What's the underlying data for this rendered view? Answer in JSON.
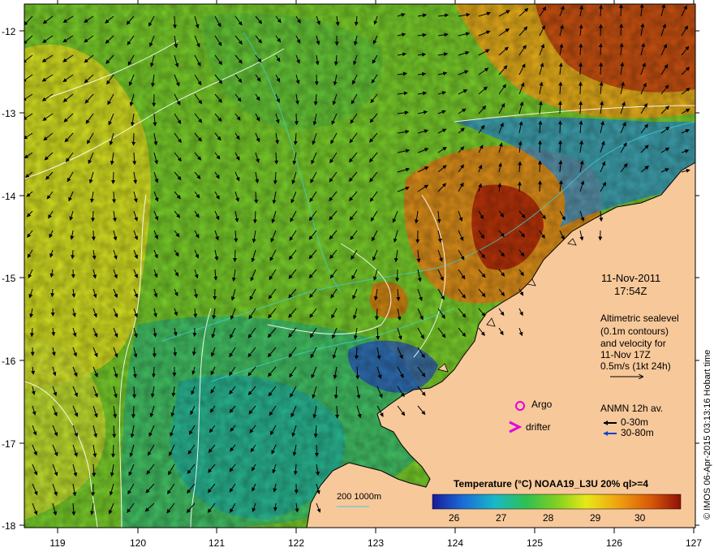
{
  "map": {
    "date": "11-Nov-2011",
    "time": "17:54Z",
    "credit": "© IMOS 06-Apr-2015 03:13:16 Hobart time",
    "latitude_ticks": [
      "-12",
      "-13",
      "-14",
      "-15",
      "-16",
      "-17",
      "-18"
    ],
    "longitude_ticks": [
      "119",
      "120",
      "121",
      "122",
      "123",
      "124",
      "125",
      "126",
      "127"
    ],
    "altimetry_legend": {
      "lines": [
        "Altimetric sealevel",
        "(0.1m contours)",
        "and velocity for",
        "11-Nov 17Z",
        "0.5m/s (1kt 24h)"
      ]
    },
    "markers": {
      "argo": "Argo",
      "drifter": "drifter"
    },
    "anmn_legend": {
      "title": "ANMN 12h av.",
      "shallow": "0-30m",
      "deep": "30-80m"
    },
    "bathymetry_legend": "200  1000m",
    "colorbar": {
      "title": "Temperature (°C) NOAA19_L3U 20% ql>=4",
      "ticks": [
        "26",
        "27",
        "28",
        "29",
        "30"
      ]
    },
    "colors": {
      "land": "#f7c89a",
      "marker": "#e000e0",
      "anmn_deep": "#1040d0",
      "contour": "#ffffff",
      "bathy": "#40d0d0"
    }
  }
}
